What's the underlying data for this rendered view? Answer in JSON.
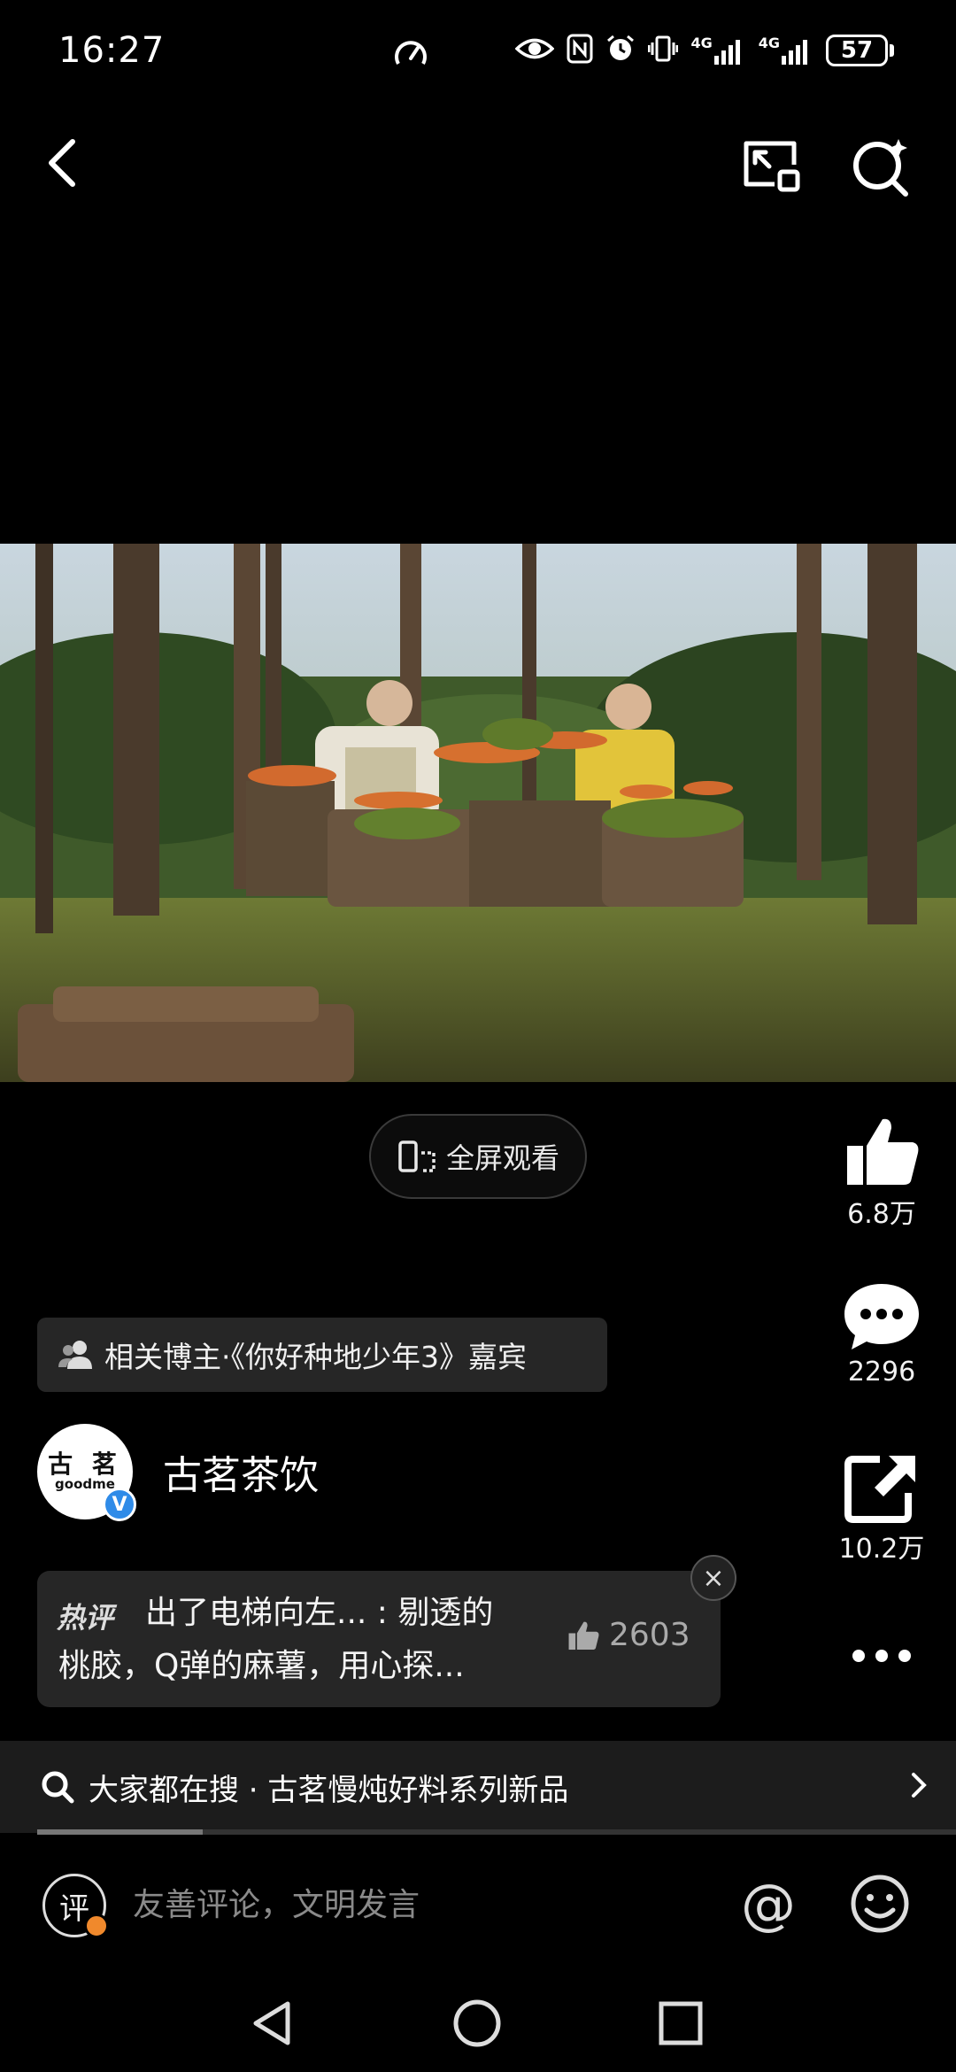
{
  "status_bar": {
    "time": "16:27",
    "network_1": "4G",
    "network_2": "4G",
    "battery": "57"
  },
  "nav": {
    "back": "back",
    "pip": "picture-in-picture",
    "search": "search"
  },
  "video": {
    "fullscreen_label": "全屏观看"
  },
  "rail": {
    "likes": "6.8万",
    "comments": "2296",
    "shares": "10.2万"
  },
  "related_tag": "相关博主·《你好种地少年3》嘉宾",
  "account": {
    "logo_cn": "古 茗",
    "logo_en": "goodme",
    "verified_mark": "V",
    "name": "古茗茶饮"
  },
  "hot_comment": {
    "badge": "热评",
    "line1": "出了电梯向左... : 剔透的",
    "line2": "桃胶，Q弹的麻薯，用心探...",
    "likes": "2603",
    "close": "×"
  },
  "search_bar": {
    "text": "大家都在搜 · 古茗慢炖好料系列新品"
  },
  "progress": 0.18,
  "comment_bar": {
    "icon_label": "评",
    "placeholder": "友善评论，文明发言",
    "at": "@"
  },
  "colors": {
    "background": "#000000",
    "panel": "#262626",
    "verified": "#2f8be8",
    "accent": "#f0892c"
  }
}
